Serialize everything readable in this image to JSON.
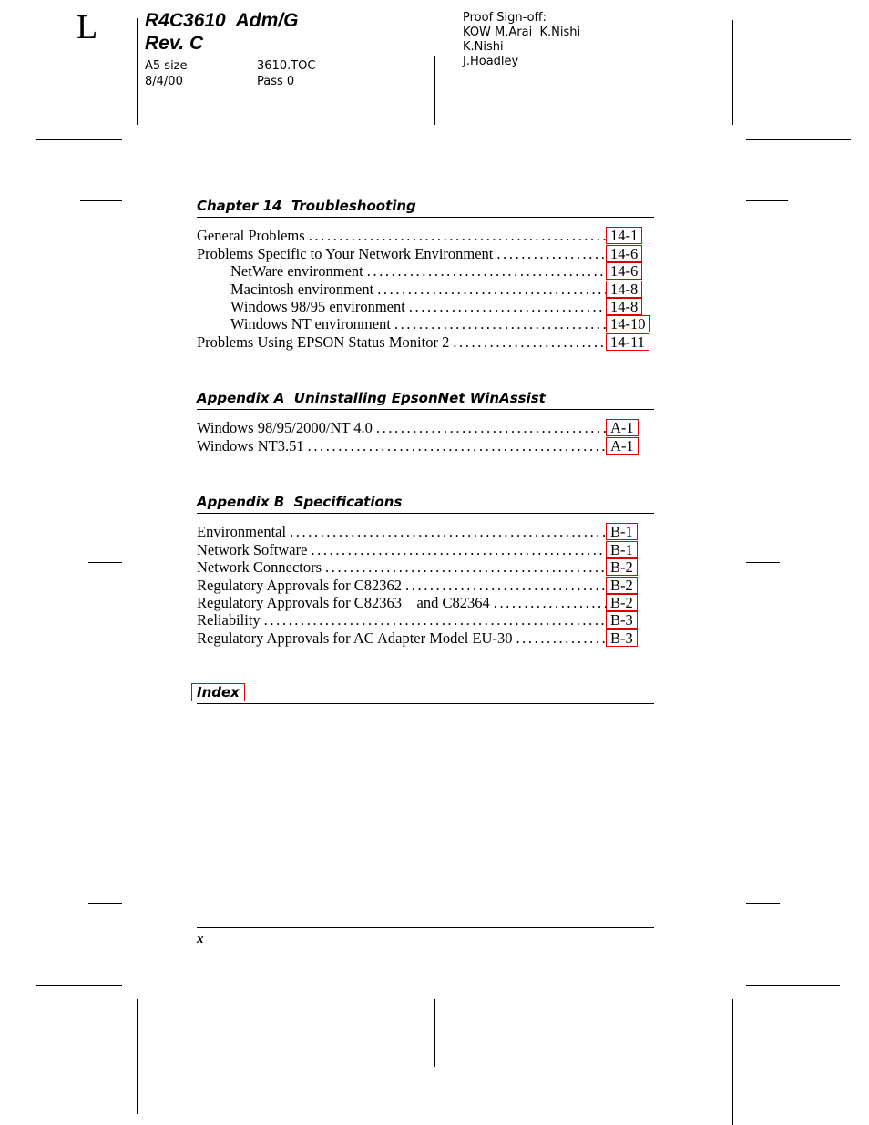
{
  "header": {
    "corner_mark": "L",
    "title_line1": "R4C3610  Adm/G",
    "title_line2": "Rev. C",
    "meta": {
      "size_label": "A5 size",
      "file_name": "3610.TOC",
      "date": "8/4/00",
      "pass": "Pass 0"
    },
    "signoff": {
      "label": "Proof Sign-off:",
      "line1": "KOW M.Arai  K.Nishi",
      "line2": "K.Nishi",
      "line3": "J.Hoadley"
    }
  },
  "toc": {
    "chapter14": {
      "heading": "Chapter 14  Troubleshooting",
      "entries": [
        {
          "title": "General Problems",
          "page": "14-1",
          "level": 1
        },
        {
          "title": "Problems Specific to Your Network Environment",
          "page": "14-6",
          "level": 1
        },
        {
          "title": "NetWare environment",
          "page": "14-6",
          "level": 2
        },
        {
          "title": "Macintosh environment",
          "page": "14-8",
          "level": 2
        },
        {
          "title": "Windows 98/95 environment",
          "page": "14-8",
          "level": 2
        },
        {
          "title": "Windows NT environment",
          "page": "14-10",
          "level": 2
        },
        {
          "title": "Problems Using EPSON Status Monitor 2",
          "page": "14-11",
          "level": 1
        }
      ]
    },
    "appendixA": {
      "heading": "Appendix A  Uninstalling EpsonNet WinAssist",
      "entries": [
        {
          "title": "Windows 98/95/2000/NT 4.0",
          "page": "A-1",
          "level": 1
        },
        {
          "title": "Windows NT3.51",
          "page": "A-1",
          "level": 1
        }
      ]
    },
    "appendixB": {
      "heading": "Appendix B  Specifications",
      "entries": [
        {
          "title": "Environmental",
          "page": "B-1",
          "level": 1
        },
        {
          "title": "Network Software",
          "page": "B-1",
          "level": 1
        },
        {
          "title": "Network Connectors",
          "page": "B-2",
          "level": 1
        },
        {
          "title": "Regulatory Approvals for C82362",
          "page": "B-2",
          "level": 1
        },
        {
          "title": "Regulatory Approvals for C82363    and C82364",
          "page": "B-2",
          "level": 1
        },
        {
          "title": "Reliability",
          "page": "B-3",
          "level": 1
        },
        {
          "title": "Regulatory Approvals for AC Adapter Model EU-30",
          "page": "B-3",
          "level": 1
        }
      ]
    },
    "index": {
      "heading": "Index"
    }
  },
  "footer": {
    "folio": "x"
  },
  "colors": {
    "link_box": "#e00000",
    "text": "#000000"
  }
}
